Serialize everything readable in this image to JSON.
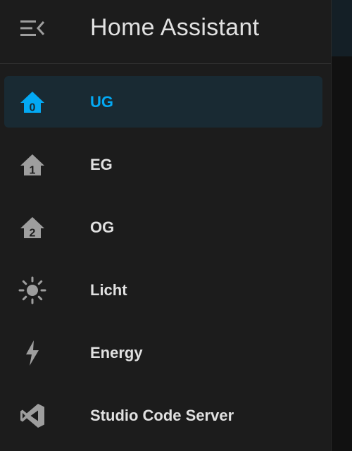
{
  "header": {
    "title": "Home Assistant",
    "menu_icon": "menu-collapse-icon"
  },
  "sidebar": {
    "items": [
      {
        "label": "UG",
        "icon": "home-floor-0-icon",
        "active": true
      },
      {
        "label": "EG",
        "icon": "home-floor-1-icon",
        "active": false
      },
      {
        "label": "OG",
        "icon": "home-floor-2-icon",
        "active": false
      },
      {
        "label": "Licht",
        "icon": "weather-sunny-icon",
        "active": false
      },
      {
        "label": "Energy",
        "icon": "lightning-bolt-icon",
        "active": false
      },
      {
        "label": "Studio Code Server",
        "icon": "vscode-icon",
        "active": false
      }
    ]
  },
  "colors": {
    "accent": "#03a9f4",
    "icon": "#9e9e9e",
    "text": "#e1e1e1",
    "background": "#1c1c1c",
    "active_background": "#192a33"
  }
}
